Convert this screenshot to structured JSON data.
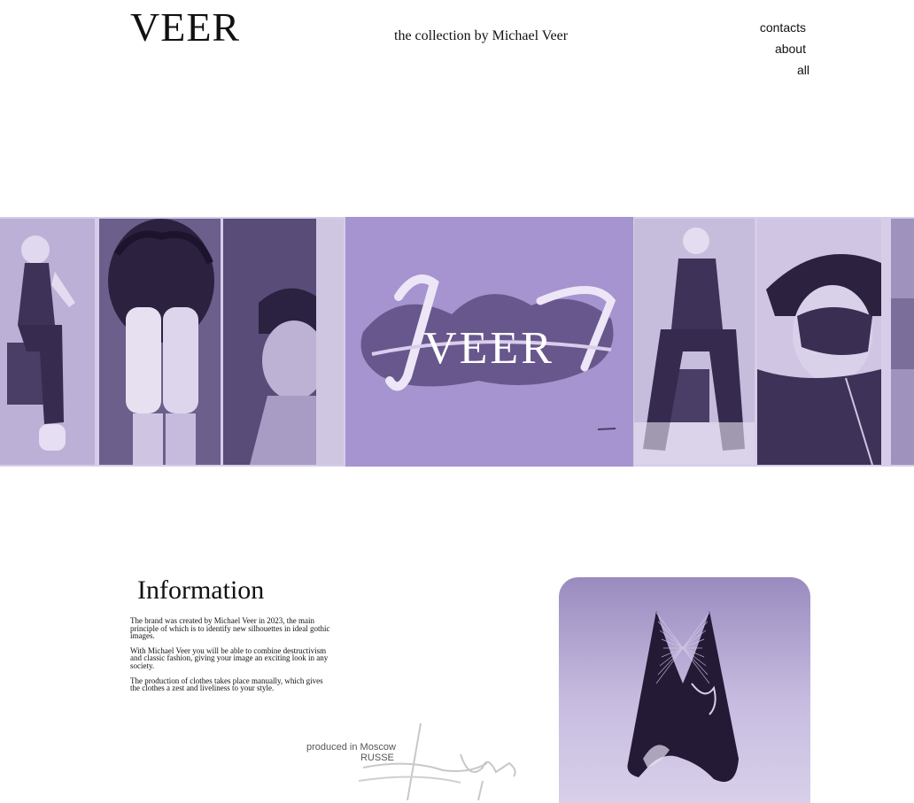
{
  "header": {
    "logo": "VEER",
    "tagline": "the collection by Michael Veer",
    "nav": [
      "contacts",
      "about",
      "all"
    ]
  },
  "banner": {
    "center_logo": "VEER",
    "colors": {
      "strip_bg": "#d7cde9",
      "center_bg": "#a594cf",
      "dark": "#4a3d66"
    }
  },
  "info": {
    "title": "Information",
    "paragraphs": [
      "The brand was created by Michael Veer in 2023, the main principle of which is to identify new silhouettes in ideal gothic images.",
      "With Michael Veer you will be able to combine destructivism and classic fashion, giving your image an exciting look in any society.",
      "The production of clothes takes place manually, which gives the clothes a zest and liveliness to your style."
    ]
  },
  "footer_note": {
    "line1": "produced in Moscow",
    "line2": "RUSSE"
  }
}
